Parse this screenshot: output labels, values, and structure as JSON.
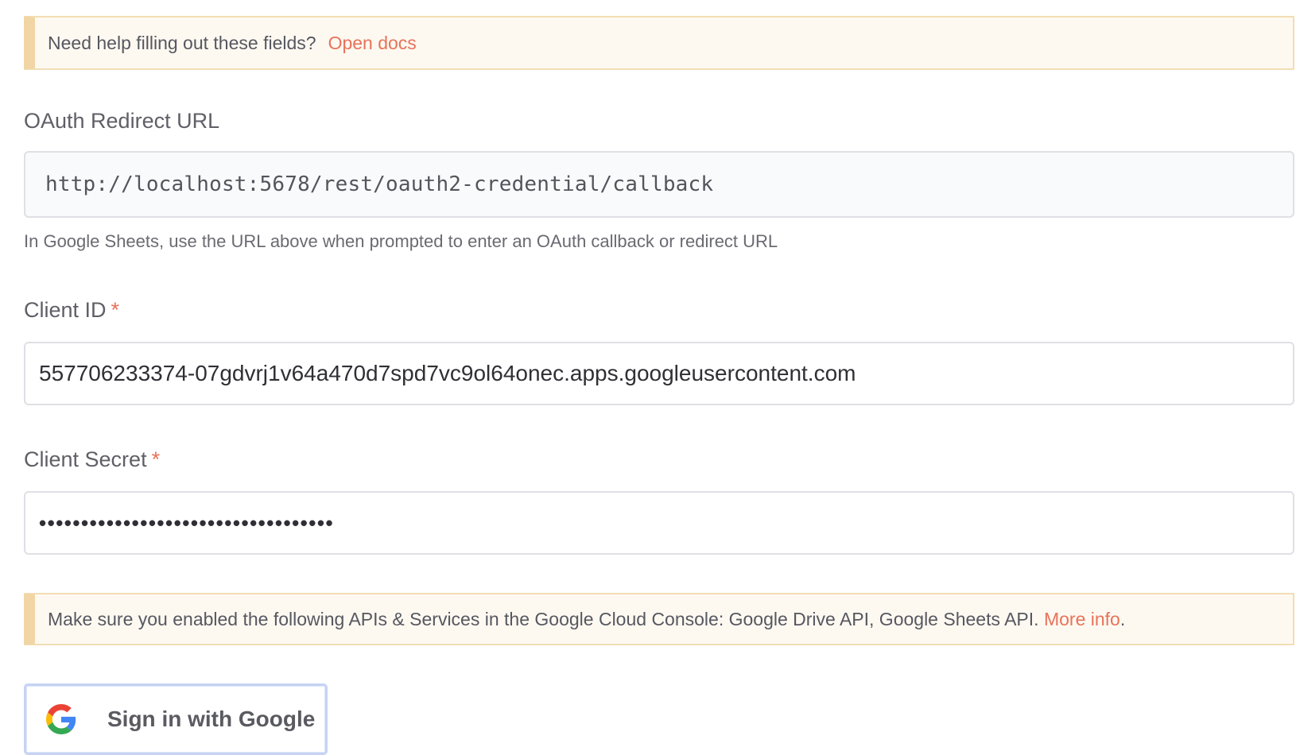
{
  "help_callout": {
    "text": "Need help filling out these fields?",
    "link_label": "Open docs"
  },
  "redirect": {
    "label": "OAuth Redirect URL",
    "value": "http://localhost:5678/rest/oauth2-credential/callback",
    "hint": "In Google Sheets, use the URL above when prompted to enter an OAuth callback or redirect URL"
  },
  "client_id": {
    "label": "Client ID",
    "required_mark": "*",
    "value": "557706233374-07gdvrj1v64a470d7spd7vc9ol64onec.apps.googleusercontent.com"
  },
  "client_secret": {
    "label": "Client Secret",
    "required_mark": "*",
    "value": "•••••••••••••••••••••••••••••••••••"
  },
  "apis_callout": {
    "text": "Make sure you enabled the following APIs & Services in the Google Cloud Console: Google Drive API, Google Sheets API. ",
    "link_label": "More info",
    "trailing": "."
  },
  "google_button": {
    "label": "Sign in with Google",
    "icon": "google-g-icon"
  },
  "colors": {
    "accent": "#e8735a",
    "callout_bg": "#fdf9f1",
    "callout_border": "#f2d5a5",
    "field_border": "#dfe0e4"
  }
}
